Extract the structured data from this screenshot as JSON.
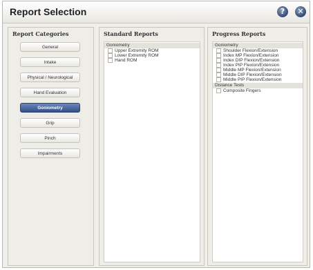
{
  "window": {
    "title": "Report Selection"
  },
  "titlebar": {
    "help_glyph": "?",
    "close_glyph": "✕"
  },
  "categories_panel": {
    "heading": "Report Categories",
    "items": [
      {
        "label": "General"
      },
      {
        "label": "Intake"
      },
      {
        "label": "Physical / Neurological"
      },
      {
        "label": "Hand Evaluation"
      },
      {
        "label": "Goniometry",
        "selected": true
      },
      {
        "label": "Grip"
      },
      {
        "label": "Pinch"
      },
      {
        "label": "Impairments"
      }
    ]
  },
  "standard_panel": {
    "heading": "Standard Reports",
    "groups": [
      {
        "title": "Goniometry",
        "items": [
          "Upper Extremity ROM",
          "Lower Extremity ROM",
          "Hand ROM"
        ]
      }
    ]
  },
  "progress_panel": {
    "heading": "Progress Reports",
    "groups": [
      {
        "title": "Goniometry",
        "items": [
          "Shoulder Flexion/Extension",
          "Index MP Flexion/Extension",
          "Index DIP Flexion/Extension",
          "Index PIP Flexion/Extension",
          "Middle MP Flexion/Extension",
          "Middle DIP Flexion/Extension",
          "Middle PIP Flexion/Extension"
        ]
      },
      {
        "title": "Distance Tests",
        "items": [
          "Composite Fingers"
        ]
      }
    ]
  },
  "colors": {
    "accent": "#344f84",
    "panel_bg": "#efede8"
  },
  "icons": {
    "help": "help-icon",
    "close": "close-icon"
  }
}
